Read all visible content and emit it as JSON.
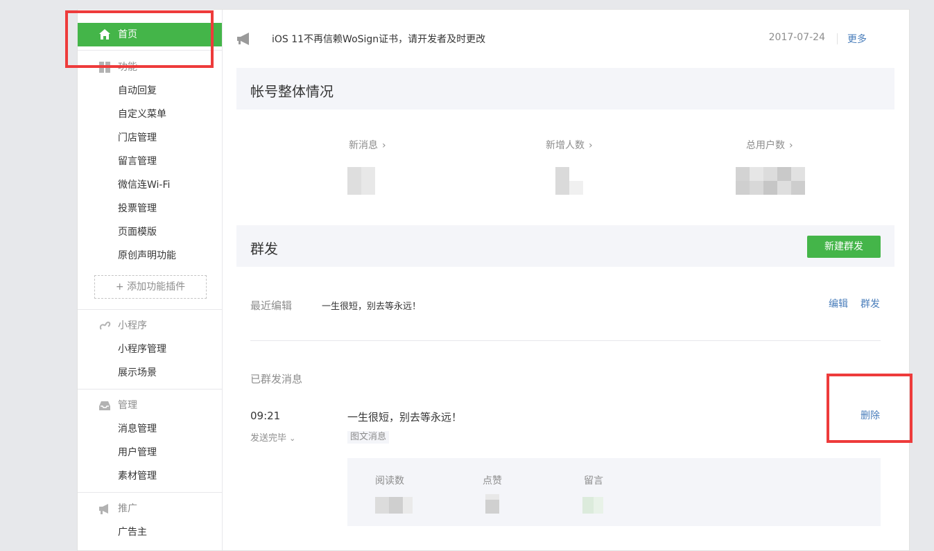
{
  "sidebar": {
    "home": "首页",
    "groups": [
      {
        "title": "功能",
        "icon": "grid-icon",
        "items": [
          "自动回复",
          "自定义菜单",
          "门店管理",
          "留言管理",
          "微信连Wi-Fi",
          "投票管理",
          "页面模版",
          "原创声明功能"
        ]
      },
      {
        "title": "小程序",
        "icon": "mini-program-icon",
        "items": [
          "小程序管理",
          "展示场景"
        ]
      },
      {
        "title": "管理",
        "icon": "inbox-icon",
        "items": [
          "消息管理",
          "用户管理",
          "素材管理"
        ]
      },
      {
        "title": "推广",
        "icon": "megaphone-icon",
        "items": [
          "广告主"
        ]
      }
    ],
    "add_plugin": "添加功能插件"
  },
  "notice": {
    "text": "iOS 11不再信赖WoSign证书，请开发者及时更改",
    "date": "2017-07-24",
    "more": "更多"
  },
  "overview": {
    "title": "帐号整体情况",
    "stats": [
      "新消息",
      "新增人数",
      "总用户数"
    ]
  },
  "mass": {
    "title": "群发",
    "new_button": "新建群发",
    "recent_label": "最近编辑",
    "recent_text": "一生很短，别去等永远！",
    "edit": "编辑",
    "send": "群发",
    "sent_label": "已群发消息",
    "sent_time": "09:21",
    "sent_status": "发送完毕",
    "sent_text": "一生很短，别去等永远！",
    "sent_type": "图文消息",
    "delete": "删除",
    "metrics": [
      "阅读数",
      "点赞",
      "留言"
    ]
  },
  "colors": {
    "accent": "#44b549",
    "link": "#4a7ebb",
    "annotation": "#ee3b3b"
  }
}
